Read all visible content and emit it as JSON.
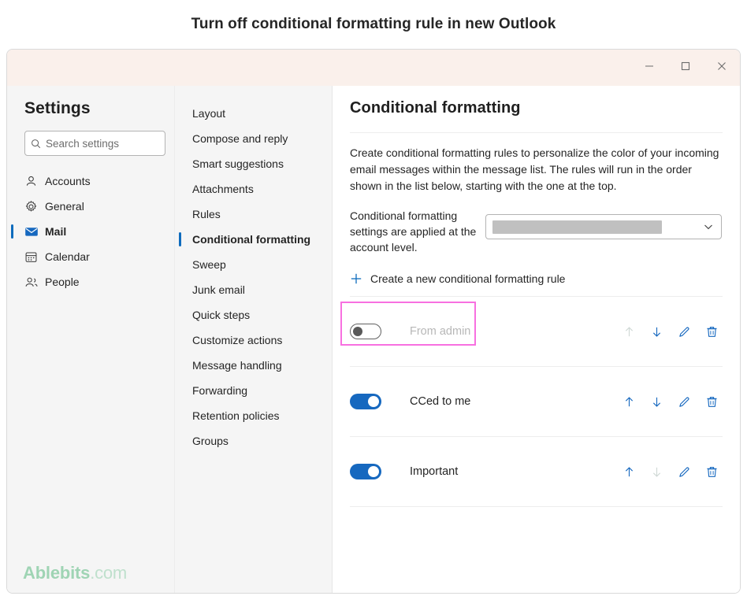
{
  "page": {
    "heading": "Turn off conditional formatting rule in new Outlook"
  },
  "window": {
    "controls": {
      "minimize": "minimize-button",
      "maximize": "maximize-button",
      "close": "close-button"
    }
  },
  "sidebar": {
    "title": "Settings",
    "search": {
      "placeholder": "Search settings",
      "value": "",
      "icon": "search-icon"
    },
    "items": [
      {
        "label": "Accounts",
        "icon": "person-icon",
        "selected": false
      },
      {
        "label": "General",
        "icon": "gear-icon",
        "selected": false
      },
      {
        "label": "Mail",
        "icon": "mail-icon",
        "selected": true
      },
      {
        "label": "Calendar",
        "icon": "calendar-icon",
        "selected": false
      },
      {
        "label": "People",
        "icon": "people-icon",
        "selected": false
      }
    ],
    "watermark": {
      "bold": "Ablebits",
      "light": ".com"
    }
  },
  "subnav": {
    "items": [
      {
        "label": "Layout",
        "selected": false
      },
      {
        "label": "Compose and reply",
        "selected": false
      },
      {
        "label": "Smart suggestions",
        "selected": false
      },
      {
        "label": "Attachments",
        "selected": false
      },
      {
        "label": "Rules",
        "selected": false
      },
      {
        "label": "Conditional formatting",
        "selected": true
      },
      {
        "label": "Sweep",
        "selected": false
      },
      {
        "label": "Junk email",
        "selected": false
      },
      {
        "label": "Quick steps",
        "selected": false
      },
      {
        "label": "Customize actions",
        "selected": false
      },
      {
        "label": "Message handling",
        "selected": false
      },
      {
        "label": "Forwarding",
        "selected": false
      },
      {
        "label": "Retention policies",
        "selected": false
      },
      {
        "label": "Groups",
        "selected": false
      }
    ]
  },
  "main": {
    "title": "Conditional formatting",
    "description": "Create conditional formatting rules to personalize the color of your incoming email messages within the message list. The rules will run in the order shown in the list below, starting with the one at the top.",
    "account_label": "Conditional formatting settings are applied at the account level.",
    "account_select": {
      "value": "",
      "redacted": true,
      "chevron_icon": "chevron-down-icon"
    },
    "create_rule": {
      "plus_icon": "plus-icon",
      "label": "Create a new conditional formatting rule"
    },
    "rules": [
      {
        "name": "From admin",
        "enabled": false,
        "highlighted": true,
        "move_up_enabled": false,
        "move_down_enabled": true
      },
      {
        "name": "CCed to me",
        "enabled": true,
        "highlighted": false,
        "move_up_enabled": true,
        "move_down_enabled": true
      },
      {
        "name": "Important",
        "enabled": true,
        "highlighted": false,
        "move_up_enabled": true,
        "move_down_enabled": false
      }
    ],
    "action_icons": {
      "move_up": "arrow-up-icon",
      "move_down": "arrow-down-icon",
      "edit": "pencil-icon",
      "delete": "trash-icon"
    }
  },
  "colors": {
    "accent_blue": "#1668bf",
    "titlebar": "#faf0eb",
    "panel_gray": "#f5f5f5",
    "highlight_pink": "#f870e0",
    "watermark_green": "#9fd4b4",
    "disabled_gray": "#cfd8d5"
  }
}
